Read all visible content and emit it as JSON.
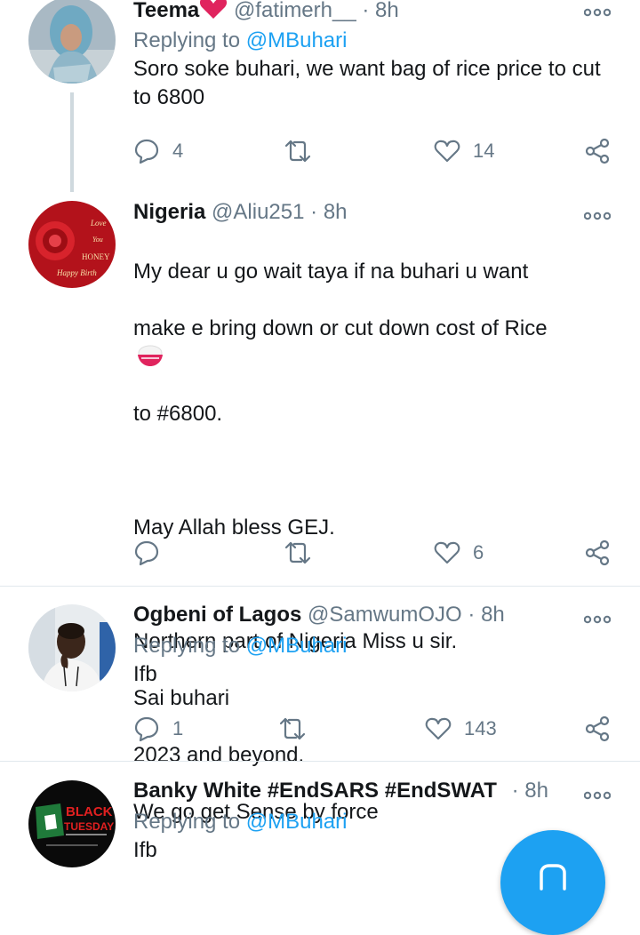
{
  "colors": {
    "accent": "#1da1f2",
    "muted": "#657786",
    "heart_red": "#e0245e",
    "fab": "#1da1f2"
  },
  "tweets": [
    {
      "name": "Teema",
      "name_emoji": "heart-icon",
      "handle": "@fatimerh__",
      "dot": "·",
      "time": "8h",
      "replying_label": "Replying to",
      "replying_to": "@MBuhari",
      "text": "Soro soke buhari, we want bag of rice price to cut to 6800",
      "reply_count": "4",
      "retweet_count": "",
      "like_count": "14"
    },
    {
      "name": "Nigeria",
      "handle": "@Aliu251",
      "dot": "·",
      "time": "8h",
      "text_lines": [
        "My dear u go wait taya if na buhari u want",
        "make e bring down or cut down cost of Rice",
        "to #6800.",
        "",
        "May Allah bless GEJ.",
        "",
        "Northern part of Nigeria Miss u sir.",
        "Sai buhari",
        "2023 and beyond.",
        "We go get Sense by force"
      ],
      "text_emoji": "rice-bowl-icon",
      "reply_count": "",
      "retweet_count": "",
      "like_count": "6"
    },
    {
      "name": "Ogbeni of Lagos",
      "handle": "@SamwumOJO",
      "dot": "·",
      "time": "8h",
      "replying_label": "Replying to",
      "replying_to": "@MBuhari",
      "text": "Ifb",
      "reply_count": "1",
      "retweet_count": "",
      "like_count": "143"
    },
    {
      "name": "Banky White #EndSARS #EndSWAT",
      "handle": "",
      "dot": "·",
      "time": "8h",
      "replying_label": "Replying to",
      "replying_to": "@MBuhari",
      "text": "Ifb",
      "avatar_text_1": "BLACK",
      "avatar_text_2": "TUESDAY"
    }
  ],
  "avatars": {
    "nigeria_card_lines": [
      "Love",
      "You",
      "HONEY",
      "Happy Birth"
    ]
  },
  "icons": {
    "reply": "reply-icon",
    "retweet": "retweet-icon",
    "like": "heart-outline-icon",
    "share": "share-icon",
    "more": "more-dots-icon",
    "compose": "compose-icon"
  }
}
